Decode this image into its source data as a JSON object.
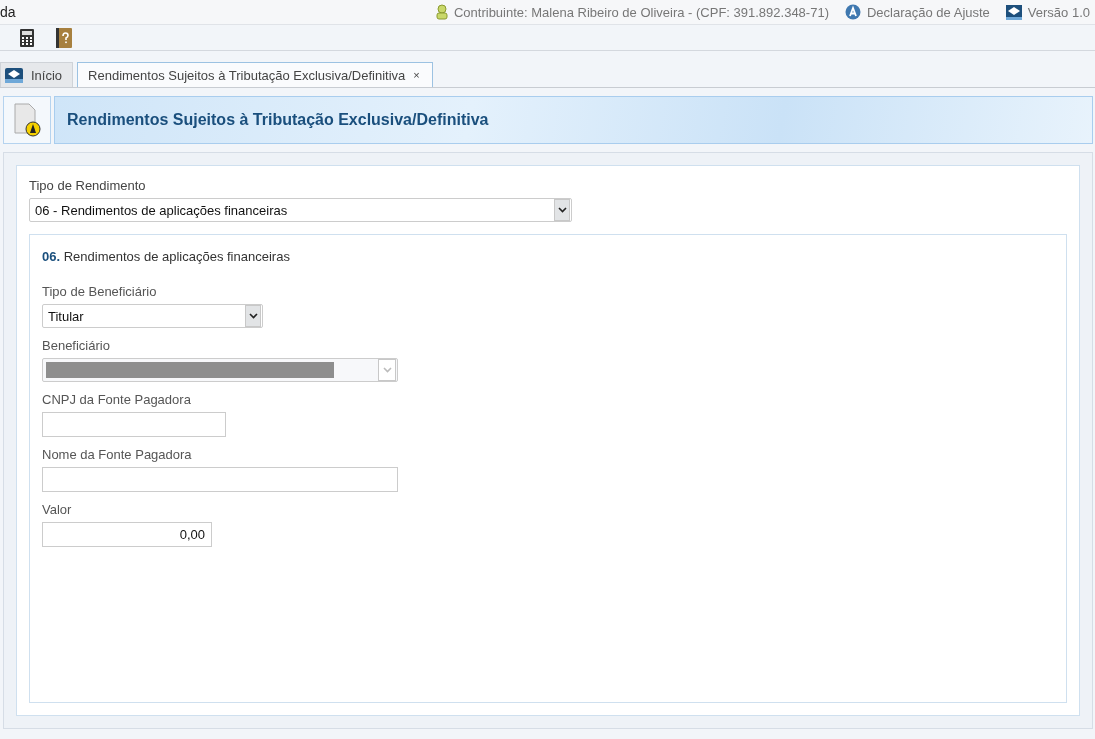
{
  "top_bar": {
    "app_title_fragment": "da",
    "contributor": "Contribuinte: Malena Ribeiro de Oliveira - (CPF: 391.892.348-71)",
    "declaration": "Declaração de Ajuste",
    "version": "Versão 1.0"
  },
  "tabs": [
    {
      "label": "Início",
      "selected": false
    },
    {
      "label": "Rendimentos Sujeitos à Tributação Exclusiva/Definitiva",
      "selected": true,
      "close_glyph": "×"
    }
  ],
  "header": {
    "title": "Rendimentos Sujeitos à Tributação Exclusiva/Definitiva"
  },
  "income_type": {
    "label": "Tipo de Rendimento",
    "value": "06 - Rendimentos de aplicações financeiras"
  },
  "section": {
    "number": "06.",
    "title": "Rendimentos de aplicações financeiras",
    "fields": [
      {
        "kind": "select",
        "label": "Tipo de Beneficiário",
        "value": "Titular",
        "disabled": false
      },
      {
        "kind": "select",
        "label": "Beneficiário",
        "disabled": true,
        "redacted": true
      },
      {
        "kind": "input",
        "label": "CNPJ da Fonte Pagadora"
      },
      {
        "kind": "input",
        "label": "Nome da Fonte Pagadora"
      },
      {
        "kind": "input",
        "label": "Valor",
        "value": "0,00"
      }
    ]
  }
}
